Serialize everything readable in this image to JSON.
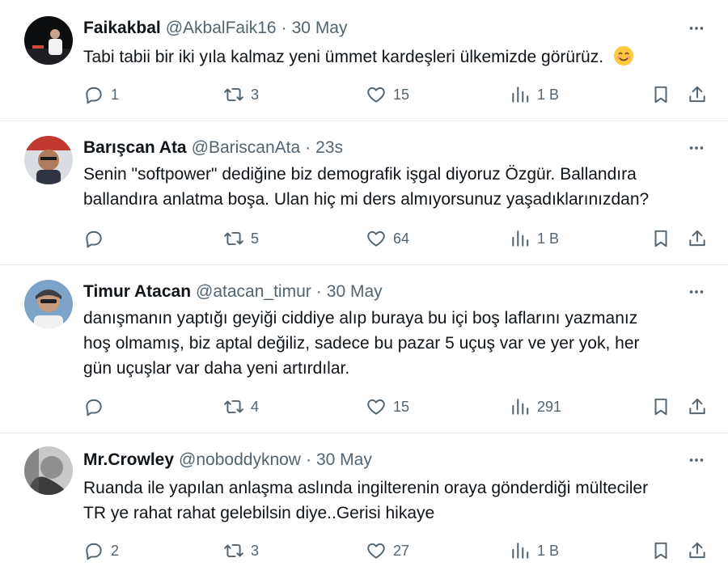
{
  "tweets": [
    {
      "name": "Faikakbal",
      "handle": "@AkbalFaik16",
      "time": "30 May",
      "text_lines": [
        "Tabi tabii bir iki yıla kalmaz yeni ümmet kardeşleri ülkemizde görürüz."
      ],
      "has_emoji": true,
      "emoji": "smiling-face-emoji",
      "replies": "1",
      "retweets": "3",
      "likes": "15",
      "views": "1 B"
    },
    {
      "name": "Barışcan Ata",
      "handle": "@BariscanAta",
      "time": "23s",
      "text_lines": [
        "Senin \"softpower\" dediğine biz demografik işgal diyoruz Özgür. Ballandıra",
        "ballandıra anlatma boşa. Ulan hiç mi ders almıyorsunuz yaşadıklarınızdan?"
      ],
      "replies": "",
      "retweets": "5",
      "likes": "64",
      "views": "1 B"
    },
    {
      "name": "Timur Atacan",
      "handle": "@atacan_timur",
      "time": "30 May",
      "text_lines": [
        "danışmanın yaptığı geyiği ciddiye alıp buraya bu içi boş laflarını yazmanız",
        "hoş olmamış, biz aptal değiliz, sadece bu pazar 5 uçuş var ve yer yok, her",
        "gün uçuşlar var daha yeni artırdılar."
      ],
      "replies": "",
      "retweets": "4",
      "likes": "15",
      "views": "291"
    },
    {
      "name": "Mr.Crowley",
      "handle": "@noboddyknow",
      "time": "30 May",
      "text_lines": [
        "Ruanda ile yapılan anlaşma aslında ingilterenin oraya gönderdiği mülteciler",
        "TR ye rahat rahat gelebilsin diye..Gerisi hikaye"
      ],
      "replies": "2",
      "retweets": "3",
      "likes": "27",
      "views": "1 B"
    }
  ],
  "separator": "·",
  "colors": {
    "text": "#0f1419",
    "secondary": "#536471",
    "divider": "#e6e9ec",
    "emoji": "#ffc83d"
  },
  "icons": [
    "reply-icon",
    "retweet-icon",
    "like-icon",
    "views-icon",
    "bookmark-icon",
    "share-icon",
    "more-icon"
  ]
}
